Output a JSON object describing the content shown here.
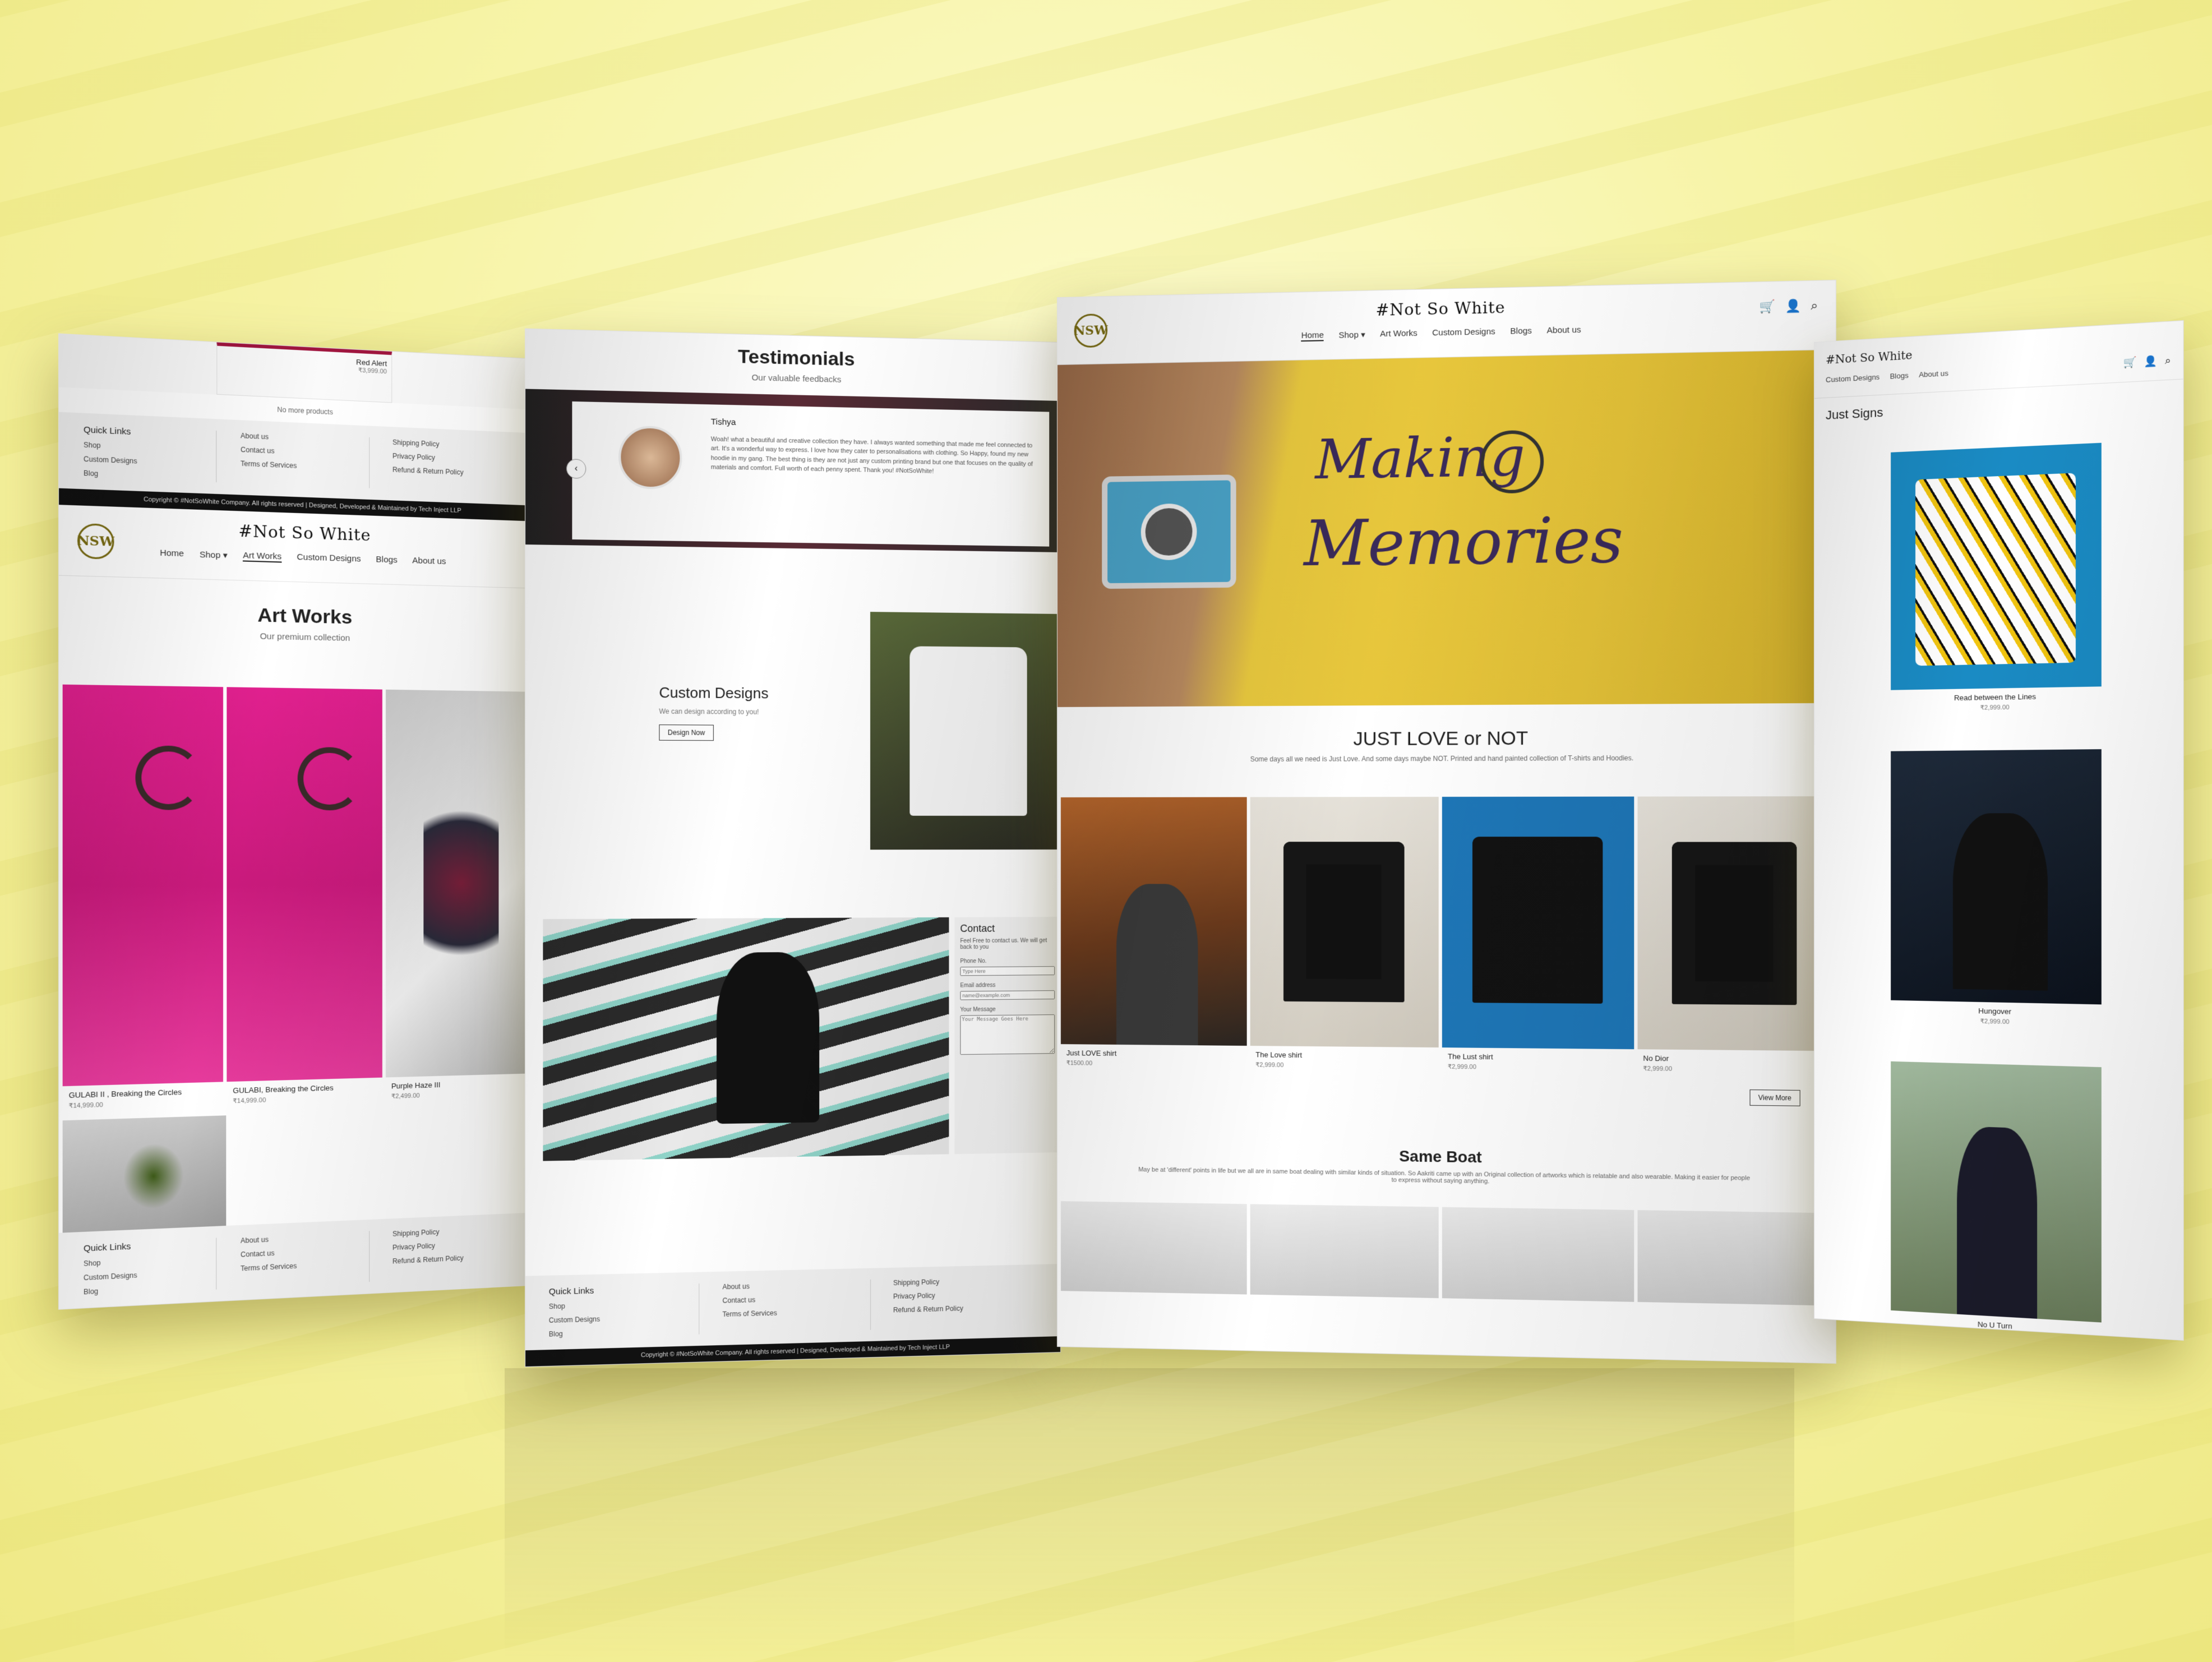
{
  "brand": {
    "name": "#Not So White",
    "logo_text": "NSW"
  },
  "nav": [
    "Home",
    "Shop ▾",
    "Art Works",
    "Custom Designs",
    "Blogs",
    "About us"
  ],
  "artworks_page": {
    "top_product": {
      "name": "Red Alert",
      "price": "₹3,999.00"
    },
    "no_more": "No more products",
    "title": "Art Works",
    "subtitle": "Our premium collection",
    "items": [
      {
        "name": "GULABI II , Breaking the Circles",
        "price": "₹14,999.00"
      },
      {
        "name": "GULABI, Breaking the Circles",
        "price": "₹14,999.00"
      },
      {
        "name": "Purple Haze III",
        "price": "₹2,499.00"
      }
    ]
  },
  "testimonials_page": {
    "title": "Testimonials",
    "subtitle": "Our valuable feedbacks",
    "person": "Tishya",
    "quote": "Woah! what a beautiful and creative collection they have. I always wanted something that made me feel connected to art. It's a wonderful way to express. I love how they cater to personalisations with clothing. So Happy, found my new hoodie in my gang. The best thing is they are not just any custom printing brand but one that focuses on the quality of materials and comfort. Full worth of each penny spent. Thank you! #NotSoWhite!",
    "custom": {
      "title": "Custom Designs",
      "text": "We can design according to you!",
      "button": "Design Now"
    },
    "contact": {
      "title": "Contact",
      "text": "Feel Free to contact us. We will get back to you",
      "phone_label": "Phone No.",
      "phone_placeholder": "Type Here",
      "email_label": "Email address",
      "email_placeholder": "name@example.com",
      "message_label": "Your Message",
      "message_placeholder": "Your Message Goes Here"
    }
  },
  "home_page": {
    "hero_text_1": "Making",
    "hero_text_2": "Memories",
    "section1": {
      "title": "JUST LOVE or NOT",
      "subtitle": "Some days all we need is Just Love. And some days maybe NOT. Printed and hand painted collection of T-shirts and Hoodies."
    },
    "products": [
      {
        "name": "Just LOVE shirt",
        "price": "₹1500.00"
      },
      {
        "name": "The Love shirt",
        "price": "₹2,999.00"
      },
      {
        "name": "The Lust shirt",
        "price": "₹2,999.00"
      },
      {
        "name": "No Dior",
        "price": "₹2,999.00"
      }
    ],
    "view_more": "View More",
    "section2": {
      "title": "Same Boat",
      "subtitle": "May be at 'different' points in life but we all are in same boat dealing with similar kinds of situation. So Aakriti came up with an Original collection of artworks which is relatable and also wearable. Making it easier for people to express without saying anything."
    }
  },
  "listing_page": {
    "nav": [
      "Custom Designs",
      "Blogs",
      "About us"
    ],
    "title": "Just Signs",
    "items": [
      {
        "name": "Read between the Lines",
        "price": "₹2,999.00"
      },
      {
        "name": "Hungover",
        "price": "₹2,999.00"
      },
      {
        "name": "No U Turn",
        "price": ""
      }
    ]
  },
  "footer": {
    "quick_links": "Quick Links",
    "col1": [
      "Shop",
      "Custom Designs",
      "Blog"
    ],
    "col2": [
      "About us",
      "Contact us",
      "Terms of Services"
    ],
    "col3": [
      "Shipping Policy",
      "Privacy Policy",
      "Refund & Return Policy"
    ],
    "copyright": "Copyright © #NotSoWhite Company. All rights reserved | Designed, Developed & Maintained by Tech Inject LLP"
  },
  "colors": {
    "background": "#f7f4a8",
    "accent": "#e0208e",
    "hero_yellow": "#e8c53a"
  }
}
